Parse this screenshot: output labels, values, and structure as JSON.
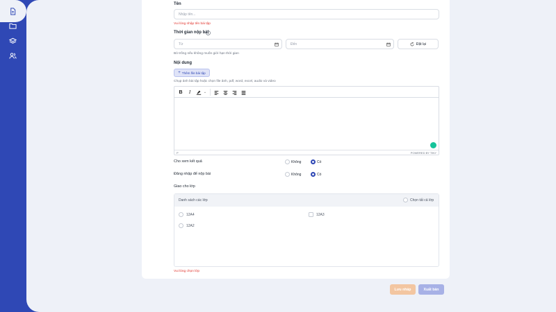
{
  "sidebar": {
    "items": [
      {
        "icon": "document-icon",
        "active": true
      },
      {
        "icon": "folder-icon",
        "active": false
      },
      {
        "icon": "layers-icon",
        "active": false
      },
      {
        "icon": "users-icon",
        "active": false
      }
    ]
  },
  "form": {
    "name_label": "Tên",
    "name_placeholder": "Nhập tên...",
    "name_error": "Vui lòng nhập tên bài tập",
    "deadline_label": "Thời gian nộp bài",
    "from_placeholder": "Từ",
    "to_placeholder": "Đến",
    "reset_label": "Đặt lại",
    "deadline_hint": "Bỏ trống nếu không muốn giới hạn thời gian",
    "content_label": "Nội dung",
    "add_file_label": "Thêm file bài tập",
    "content_hint": "Chụp ảnh bài tập hoặc chọn file ảnh, pdf, word, excel, audio và video",
    "editor": {
      "path": "P",
      "powered_by": "POWERED BY TINY"
    },
    "show_result": {
      "label": "Cho xem kết quả",
      "options": [
        "Không",
        "Có"
      ],
      "selected": "Có"
    },
    "login_required": {
      "label": "Đăng nhập để nộp bài",
      "options": [
        "Không",
        "Có"
      ],
      "selected": "Có"
    },
    "assign_label": "Giao cho lớp",
    "class_list_title": "Danh sách các lớp",
    "select_all_label": "Chọn tất cả lớp",
    "classes": [
      "12A4",
      "12A3",
      "12A2"
    ],
    "class_error": "Vui lòng chọn lớp"
  },
  "actions": {
    "save_draft": "Lưu nháp",
    "publish": "Xuất bản"
  },
  "colors": {
    "brand": "#2f48b5",
    "error": "#e0322b",
    "draft": "#f3c6a1",
    "publish": "#a7b1e6"
  }
}
